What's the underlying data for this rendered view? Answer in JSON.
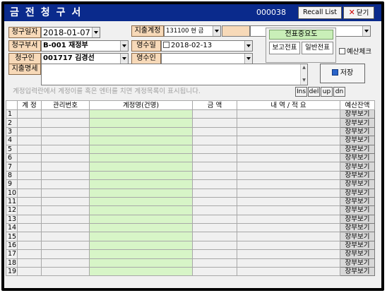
{
  "window": {
    "title": "금전청구서",
    "doc_number": "000038",
    "recall_label": "Recall List",
    "close_label": "닫기"
  },
  "form": {
    "claim_date_label": "청구일자",
    "claim_date_value": "2018-01-07",
    "expense_account_label": "지출계정",
    "expense_account_value": "131100 현 금",
    "expense_account_extra": "",
    "dept_label": "청구부서",
    "dept_value": "B-001  재정부",
    "receipt_date_label": "영수일",
    "receipt_date_value": "2018-02-13",
    "claimant_label": "청구인",
    "claimant_value": "001717 김경선",
    "receiver_label": "영수인",
    "receiver_value": "",
    "memo_label": "지출명세",
    "memo_value": ""
  },
  "voucher": {
    "title": "전표중요도",
    "report_label": "보고전표",
    "general_label": "일반전표"
  },
  "budget_check_label": "예산체크",
  "save_label": "저장",
  "hint_text": "계정입력란에서 계정이를 혹은 엔터를 치면 계정목록이 표시됩니다.",
  "row_buttons": {
    "ins": "Ins",
    "del": "del",
    "up": "up",
    "dn": "dn"
  },
  "table": {
    "headers": [
      "",
      "계 정",
      "관리번호",
      "계정명(건명)",
      "금 액",
      "내 역 / 적 요",
      "예산잔액"
    ],
    "ledger_label": "장부보기",
    "row_numbers": [
      "1",
      "2",
      "3",
      "4",
      "5",
      "6",
      "7",
      "8",
      "9",
      "10",
      "11",
      "12",
      "13",
      "14",
      "15",
      "16",
      "17",
      "18",
      "19"
    ]
  },
  "colors": {
    "titlebar": "#0a2a8c",
    "label_bg": "#f7d9b8",
    "account_column": "#d7f5c7",
    "voucher_title": "#c9efb8"
  }
}
